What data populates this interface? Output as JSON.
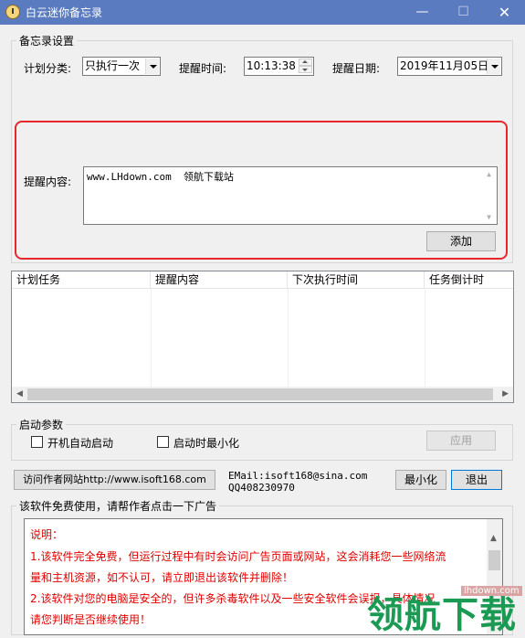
{
  "window": {
    "title": "白云迷你备忘录",
    "controls": {
      "minimize": "—",
      "maximize": "☐",
      "close": "✕"
    }
  },
  "memo_settings": {
    "group_label": "备忘录设置",
    "category_label": "计划分类:",
    "category_value": "只执行一次",
    "time_label": "提醒时间:",
    "time_value": "10:13:38",
    "date_label": "提醒日期:",
    "date_value": "2019年11月05日",
    "content_label": "提醒内容:",
    "content_value": "www.LHdown.com  领航下载站",
    "add_button": "添加"
  },
  "task_table": {
    "columns": [
      "计划任务",
      "提醒内容",
      "下次执行时间",
      "任务倒计时"
    ],
    "rows": []
  },
  "startup": {
    "group_label": "启动参数",
    "autostart_label": "开机自动启动",
    "autostart_checked": false,
    "minimize_label": "启动时最小化",
    "minimize_checked": false,
    "apply_button": "应用"
  },
  "footer": {
    "visit_button": "访问作者网站http://www.isoft168.com",
    "email": "EMail:isoft168@sina.com",
    "qq": "QQ408230970",
    "minimize_button": "最小化",
    "exit_button": "退出"
  },
  "notice": {
    "group_label": "该软件免费使用，请帮作者点击一下广告",
    "lines": [
      "说明：",
      "1.该软件完全免费，但运行过程中有时会访问广告页面或网站，这会消耗您一些网络流",
      "量和主机资源，如不认可，请立即退出该软件并删除！",
      "2.该软件对您的电脑是安全的，但许多杀毒软件以及一些安全软件会误报，具体情况",
      "请您判断是否继续使用！"
    ]
  },
  "watermark": {
    "site": "lhdown.com",
    "brand": "领航下载"
  },
  "colors": {
    "titlebar": "#5b7bc0",
    "highlight": "#e8262c",
    "notice_text": "#e00000",
    "watermark": "#1a9a52"
  }
}
